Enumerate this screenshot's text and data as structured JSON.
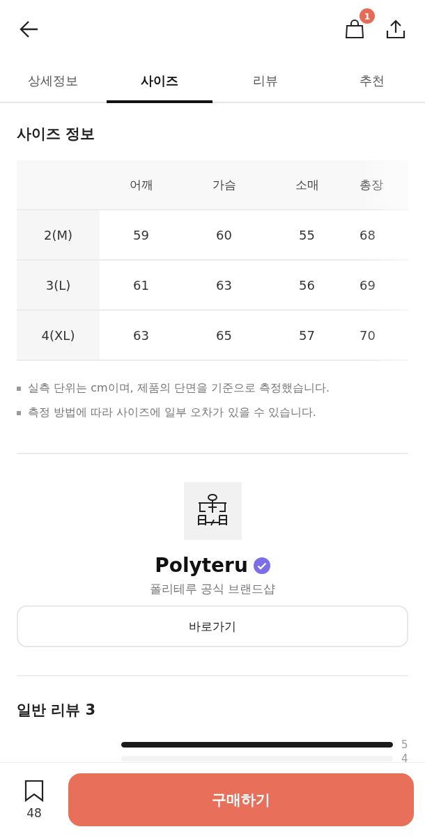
{
  "header": {
    "cart_count": "1"
  },
  "tabs": [
    {
      "label": "상세정보",
      "selected": false
    },
    {
      "label": "사이즈",
      "selected": true
    },
    {
      "label": "리뷰",
      "selected": false
    },
    {
      "label": "추천",
      "selected": false
    }
  ],
  "size_info": {
    "title": "사이즈 정보",
    "columns": [
      "어깨",
      "가슴",
      "소매",
      "총장"
    ],
    "rows": [
      {
        "size": "2(M)",
        "values": [
          "59",
          "60",
          "55",
          "68"
        ]
      },
      {
        "size": "3(L)",
        "values": [
          "61",
          "63",
          "56",
          "69"
        ]
      },
      {
        "size": "4(XL)",
        "values": [
          "63",
          "65",
          "57",
          "70"
        ]
      }
    ],
    "notes": [
      "실측 단위는 cm이며, 제품의 단면을 기준으로 측정했습니다.",
      "측정 방법에 따라 사이즈에 일부 오차가 있을 수 있습니다."
    ]
  },
  "brand": {
    "name": "Polyteru",
    "verified": true,
    "subtitle": "폴리테루 공식 브랜드샵",
    "button": "바로가기"
  },
  "reviews": {
    "title": "일반 리뷰 3",
    "distribution": [
      {
        "label": "5",
        "level": 1.0
      },
      {
        "label": "4",
        "level": 0.0
      }
    ]
  },
  "bottom_bar": {
    "bookmark_count": "48",
    "buy_button": "구매하기"
  }
}
